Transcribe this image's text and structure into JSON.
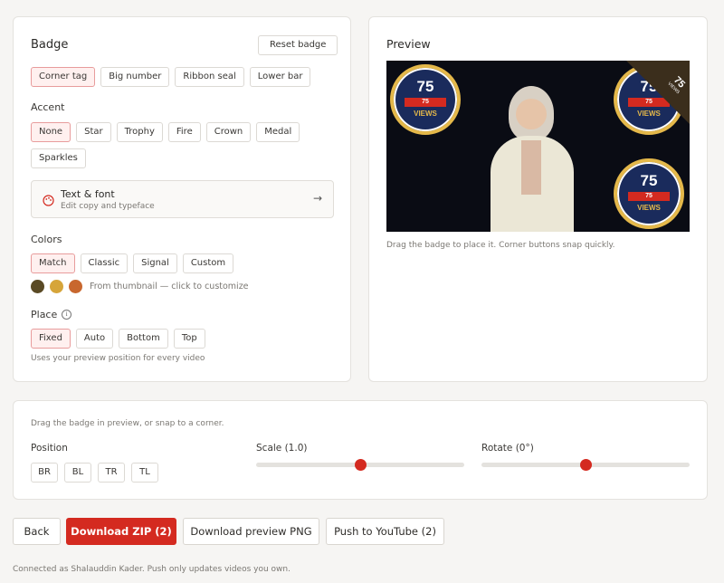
{
  "badge_panel": {
    "title": "Badge",
    "reset_label": "Reset badge",
    "styles": [
      "Corner tag",
      "Big number",
      "Ribbon seal",
      "Lower bar"
    ],
    "accent_label": "Accent",
    "accents_row1": [
      "None",
      "Star",
      "Trophy",
      "Fire",
      "Crown",
      "Medal"
    ],
    "accents_row2": [
      "Sparkles"
    ],
    "text_font": {
      "title": "Text & font",
      "subtitle": "Edit copy and typeface"
    },
    "colors_label": "Colors",
    "color_modes": [
      "Match",
      "Classic",
      "Signal",
      "Custom"
    ],
    "swatches": [
      "#5a4a25",
      "#d6a53a",
      "#c8672e"
    ],
    "swatch_hint": "From thumbnail — click to customize",
    "place_label": "Place",
    "place_modes": [
      "Fixed",
      "Auto",
      "Bottom",
      "Top"
    ],
    "place_hint": "Uses your preview position for every video"
  },
  "preview": {
    "title": "Preview",
    "badge_number": "75",
    "badge_bar": "75",
    "badge_word": "VIEWS",
    "corner_number": "75",
    "corner_word": "VIEWS",
    "hint": "Drag the badge to place it. Corner buttons snap quickly."
  },
  "controls": {
    "hint": "Drag the badge in preview, or snap to a corner.",
    "position_label": "Position",
    "positions": [
      "BR",
      "BL",
      "TR",
      "TL"
    ],
    "scale_label": "Scale (1.0)",
    "scale_value": 0.5,
    "rotate_label": "Rotate (0°)",
    "rotate_value": 0.5
  },
  "footer": {
    "back": "Back",
    "download_zip": "Download ZIP (2)",
    "download_png": "Download preview PNG",
    "push": "Push to YouTube (2)",
    "status": "Connected as Shalauddin Kader. Push only updates videos you own."
  }
}
